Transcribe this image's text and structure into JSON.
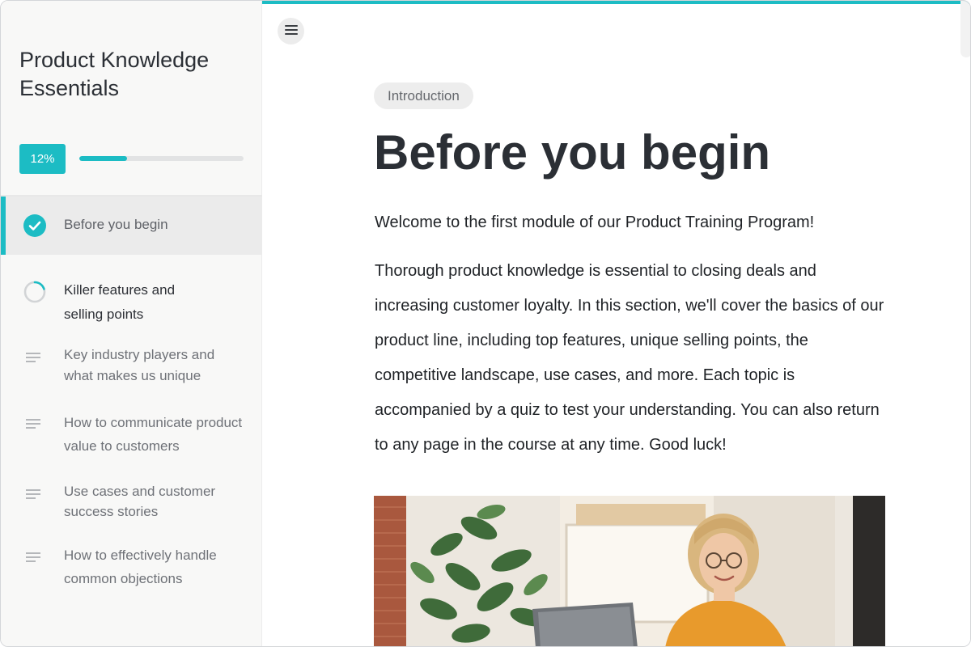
{
  "sidebar": {
    "course_title": "Product Knowledge Essentials",
    "progress_label": "12%",
    "progress_value": 0.29,
    "lessons": [
      {
        "label": "Before you begin",
        "status": "completed"
      },
      {
        "label": "Killer features and selling points",
        "status": "in-progress"
      },
      {
        "label": "Key industry players and what makes us unique",
        "status": "not-started"
      },
      {
        "label": "How to communicate product value to customers",
        "status": "not-started"
      },
      {
        "label": "Use cases and customer success stories",
        "status": "not-started"
      },
      {
        "label": "How to effectively handle common objections",
        "status": "not-started"
      }
    ]
  },
  "main": {
    "section_label": "Introduction",
    "title": "Before you begin",
    "intro": "Welcome to the first module of our Product Training Program!",
    "body": "Thorough product knowledge is essential to closing deals and increasing customer loyalty. In this section, we'll cover the basics of our product line, including top features, unique selling points, the competitive landscape, use cases, and more. Each topic is accompanied by a quiz to test your understanding. You can also return to any page in the course at any time. Good luck!"
  },
  "colors": {
    "accent": "#1cbcc4",
    "sidebar_bg": "#f8f8f7",
    "active_item_bg": "#ebebeb",
    "text_dark": "#2b2f35",
    "text_muted": "#6e7177"
  },
  "icons": {
    "menu": "hamburger-menu-icon",
    "completed": "check-circle-icon",
    "in_progress": "progress-ring-icon",
    "not_started": "text-lines-icon"
  }
}
